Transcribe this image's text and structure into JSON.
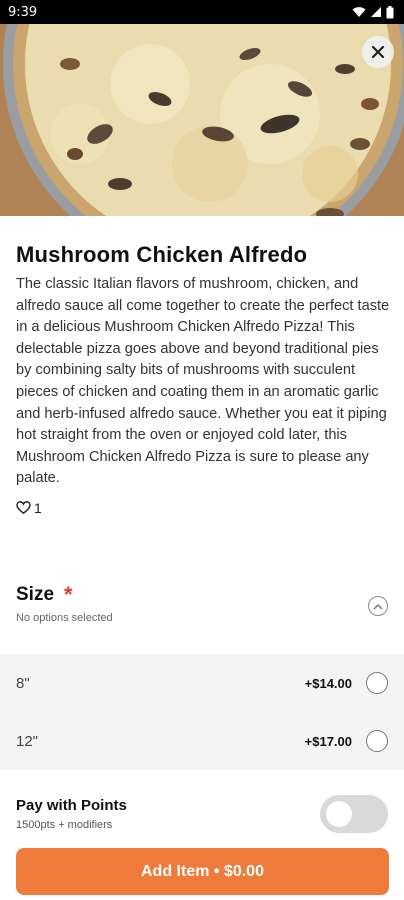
{
  "status_bar": {
    "time": "9:39"
  },
  "item": {
    "title": "Mushroom Chicken Alfredo",
    "description": "The classic Italian flavors of mushroom, chicken, and alfredo sauce all come together to create the perfect taste in a delicious Mushroom Chicken Alfredo Pizza! This delectable pizza goes above and beyond traditional pies by combining salty bits of mushrooms with succulent pieces of chicken and coating them in an aromatic garlic and herb-infused alfredo sauce. Whether you eat it piping hot straight from the oven or enjoyed cold later, this Mushroom Chicken Alfredo Pizza is sure to please any palate.",
    "likes": "1"
  },
  "size": {
    "title": "Size",
    "required_mark": "*",
    "subtitle": "No options selected",
    "options": [
      {
        "label": "8\"",
        "price": "+$14.00"
      },
      {
        "label": "12\"",
        "price": "+$17.00"
      }
    ]
  },
  "points": {
    "title": "Pay with Points",
    "subtitle": "1500pts + modifiers",
    "enabled": false
  },
  "add_button": {
    "label": "Add Item • $0.00"
  },
  "colors": {
    "accent": "#ef7b3a",
    "required": "#e23d28"
  }
}
